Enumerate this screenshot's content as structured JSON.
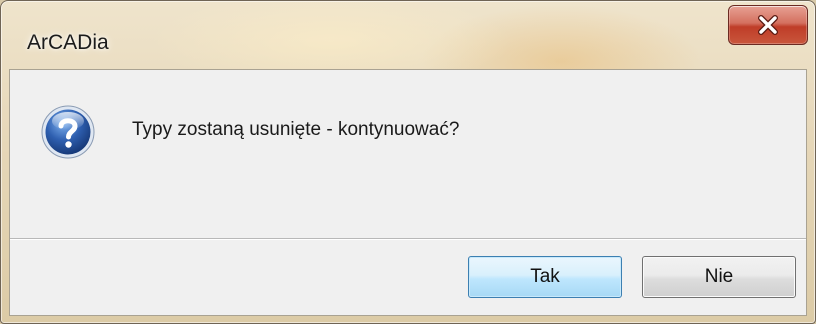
{
  "window": {
    "title": "ArCADia",
    "close_icon": "close-icon"
  },
  "dialog": {
    "icon": "question-icon",
    "message": "Typy zostaną usunięte - kontynuować?",
    "buttons": {
      "yes_label": "Tak",
      "no_label": "Nie"
    }
  },
  "colors": {
    "close_button": "#c9563c",
    "question_icon": "#2e5fb0",
    "default_button_border": "#3c7fb1"
  }
}
